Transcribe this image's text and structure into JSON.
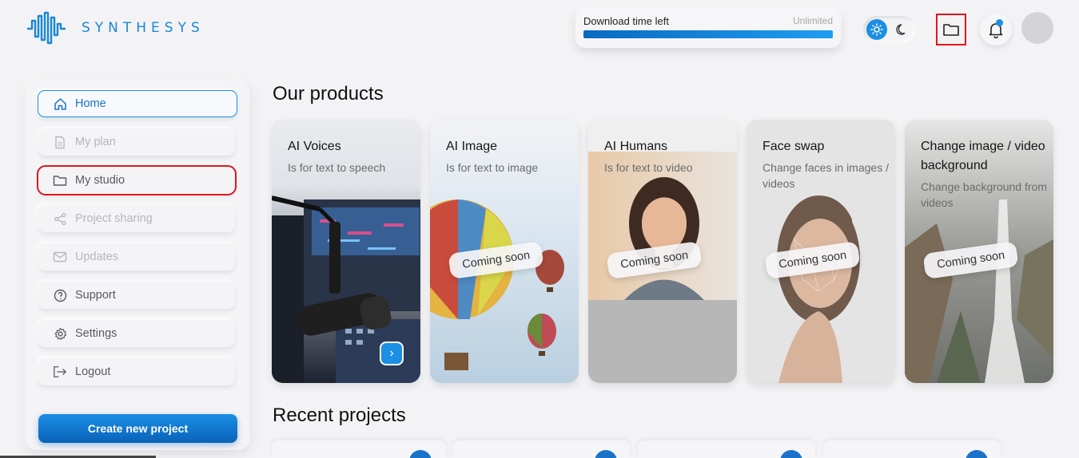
{
  "brand": {
    "name": "SYNTHESYS",
    "color": "#1a86d6"
  },
  "download": {
    "label": "Download time left",
    "value": "Unlimited",
    "progress": 1.0
  },
  "header_icons": [
    "sun-icon",
    "moon-icon",
    "folder-icon",
    "bell-icon"
  ],
  "sidebar": {
    "items": [
      {
        "label": "Home",
        "icon": "home-icon",
        "state": "active"
      },
      {
        "label": "My plan",
        "icon": "document-icon",
        "state": "disabled"
      },
      {
        "label": "My studio",
        "icon": "folder-icon",
        "state": "normal"
      },
      {
        "label": "Project sharing",
        "icon": "share-icon",
        "state": "disabled"
      },
      {
        "label": "Updates",
        "icon": "mail-icon",
        "state": "disabled"
      },
      {
        "label": "Support",
        "icon": "help-icon",
        "state": "normal"
      },
      {
        "label": "Settings",
        "icon": "gear-icon",
        "state": "normal"
      },
      {
        "label": "Logout",
        "icon": "logout-icon",
        "state": "normal"
      }
    ],
    "create_button": "Create new project"
  },
  "main": {
    "products_title": "Our products",
    "recent_title": "Recent projects",
    "products": [
      {
        "title": "AI Voices",
        "subtitle": "Is for text to speech",
        "badge": ""
      },
      {
        "title": "AI Image",
        "subtitle": "Is for text to image",
        "badge": "Coming soon"
      },
      {
        "title": "AI Humans",
        "subtitle": "Is for text to video",
        "badge": "Coming soon"
      },
      {
        "title": "Face swap",
        "subtitle": "Change faces in images / videos",
        "badge": "Coming soon"
      },
      {
        "title": "Change image / video background",
        "subtitle": "Change background from videos",
        "badge": "Coming soon"
      }
    ]
  },
  "colors": {
    "accent": "#1a8fe3",
    "highlight": "#e0161c"
  }
}
